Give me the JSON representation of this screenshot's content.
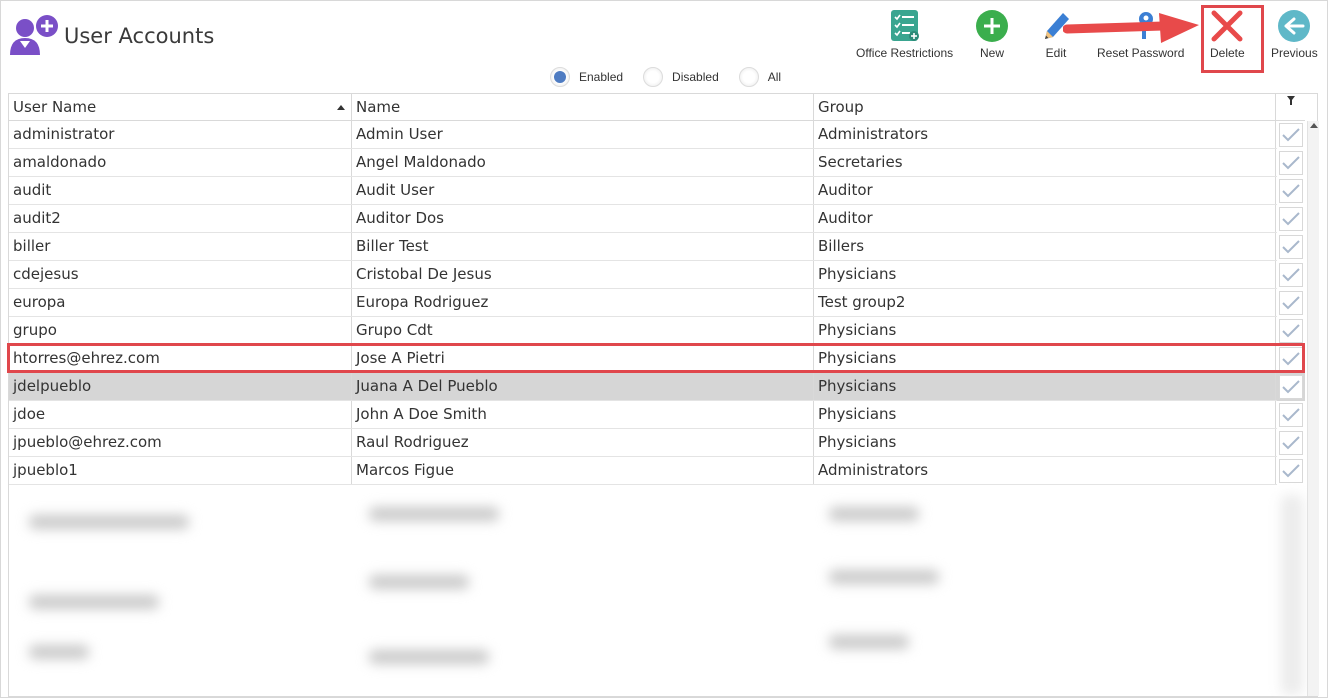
{
  "app": {
    "title": "User Accounts",
    "icon": "user-add-icon",
    "accent_color": "#7a4fc7"
  },
  "toolbar": {
    "office_restrictions": "Office Restrictions",
    "new": "New",
    "edit": "Edit",
    "reset_password": "Reset Password",
    "delete": "Delete",
    "previous": "Previous"
  },
  "filter": {
    "options": [
      "Enabled",
      "Disabled",
      "All"
    ],
    "selected": "Enabled"
  },
  "table": {
    "columns": [
      "User Name",
      "Name",
      "Group"
    ],
    "sort_column": "User Name",
    "sort_direction": "ascending",
    "rows": [
      {
        "username": "administrator",
        "name": "Admin User",
        "group": "Administrators",
        "enabled": true
      },
      {
        "username": "amaldonado",
        "name": "Angel Maldonado",
        "group": "Secretaries",
        "enabled": true
      },
      {
        "username": "audit",
        "name": "Audit User",
        "group": "Auditor",
        "enabled": true
      },
      {
        "username": "audit2",
        "name": "Auditor Dos",
        "group": "Auditor",
        "enabled": true
      },
      {
        "username": "biller",
        "name": "Biller Test",
        "group": "Billers",
        "enabled": true
      },
      {
        "username": "cdejesus",
        "name": "Cristobal De Jesus",
        "group": "Physicians",
        "enabled": true
      },
      {
        "username": "europa",
        "name": "Europa Rodriguez",
        "group": "Test group2",
        "enabled": true
      },
      {
        "username": "grupo",
        "name": "Grupo Cdt",
        "group": "Physicians",
        "enabled": true
      },
      {
        "username": "htorres@ehrez.com",
        "name": "Jose A Pietri",
        "group": "Physicians",
        "enabled": true
      },
      {
        "username": "jdelpueblo",
        "name": "Juana A Del Pueblo",
        "group": "Physicians",
        "enabled": true
      },
      {
        "username": "jdoe",
        "name": "John A Doe Smith",
        "group": "Physicians",
        "enabled": true
      },
      {
        "username": "jpueblo@ehrez.com",
        "name": "Raul Rodriguez",
        "group": "Physicians",
        "enabled": true
      },
      {
        "username": "jpueblo1",
        "name": "Marcos Figue",
        "group": "Administrators",
        "enabled": true
      }
    ],
    "selected_row": 9,
    "highlighted_row": 8
  },
  "colors": {
    "highlight": "#e0474c",
    "delete": "#e84a4a",
    "new": "#3bae4d",
    "previous": "#5fb8c8",
    "radio_on": "#4f7cc2"
  }
}
